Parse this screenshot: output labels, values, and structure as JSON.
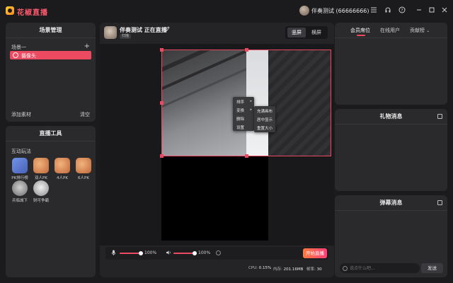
{
  "app": {
    "title": "花椒直播",
    "brand_color": "#ff5a6e",
    "accent_color": "#ec4a60"
  },
  "titlebar": {
    "user_name": "伴奏测试 (66666666)",
    "icons": [
      "menu-icon",
      "headset-icon",
      "help-icon",
      "minimize-icon",
      "maximize-icon",
      "close-icon"
    ]
  },
  "scene_panel": {
    "title": "场景管理",
    "group_name": "场景一",
    "add_scene_icon": "plus-icon",
    "sources": [
      {
        "label": "摄像头",
        "icon": "camera-icon"
      }
    ],
    "add_source_label": "添加素材",
    "clear_label": "清空"
  },
  "tools_panel": {
    "title": "直播工具",
    "section_label": "互动玩法",
    "tools": [
      {
        "label": "PK排行榜",
        "color": "#5b7fd6"
      },
      {
        "label": "双人PK",
        "color": "#d98a5a"
      },
      {
        "label": "4人PK",
        "color": "#d98a5a"
      },
      {
        "label": "6人PK",
        "color": "#d98a5a"
      },
      {
        "label": "兵临城下",
        "color": "#9a9a9a"
      },
      {
        "label": "财可争霸",
        "color": "#cfcfcf"
      }
    ]
  },
  "center": {
    "channel_title": "伴奏测试 正在直播",
    "channel_tag": "扫描",
    "orientation": {
      "portrait": "竖屏",
      "landscape": "横屏",
      "active": "portrait"
    },
    "context_menu": {
      "items": [
        {
          "label": "排序",
          "has_submenu": true
        },
        {
          "label": "变换",
          "has_submenu": true
        },
        {
          "label": "删除",
          "has_submenu": false
        },
        {
          "label": "设置",
          "has_submenu": false
        }
      ],
      "submenu": [
        "充满画布",
        "居中显示",
        "重置大小"
      ]
    },
    "controls": {
      "mic_volume_label": "100%",
      "mic_volume_value": 1.0,
      "speaker_volume_label": "100%",
      "speaker_volume_value": 1.0,
      "start_live_label": "开始直播"
    },
    "stats": {
      "cpu_label": "CPU:",
      "cpu_value": "0.15%",
      "mem_label": "内存:",
      "mem_value": "201.16MB",
      "fps_label": "帧率:",
      "fps_value": "30"
    }
  },
  "right": {
    "tabs": [
      "会员席位",
      "在线用户",
      "贡献榜"
    ],
    "active_tab": 0,
    "gift_title": "礼物消息",
    "chat_title": "弹幕消息",
    "chat_placeholder": "说点什么吧...",
    "send_label": "发送"
  }
}
